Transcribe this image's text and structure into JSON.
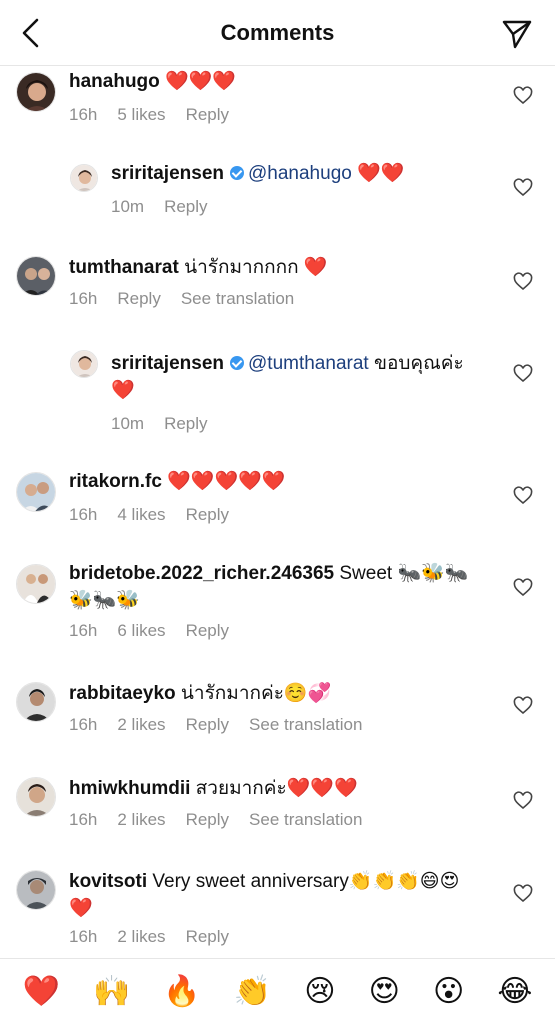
{
  "header": {
    "title": "Comments"
  },
  "comments": [
    {
      "username": "hanahugo",
      "text": " ❤️❤️❤️",
      "time": "16h",
      "likes": "5 likes",
      "reply": "Reply"
    },
    {
      "username": "sriritajensen",
      "mention": "@hanahugo",
      "text": " ❤️❤️",
      "time": "10m",
      "reply": "Reply"
    },
    {
      "username": "tumthanarat",
      "text": " น่ารักมากกกก ❤️",
      "time": "16h",
      "reply": "Reply",
      "translate": "See translation"
    },
    {
      "username": "sriritajensen",
      "mention": "@tumthanarat",
      "text": " ขอบคุณค่ะ❤️",
      "time": "10m",
      "reply": "Reply"
    },
    {
      "username": "ritakorn.fc",
      "text": " ❤️❤️❤️❤️❤️",
      "time": "16h",
      "likes": "4 likes",
      "reply": "Reply"
    },
    {
      "username": "bridetobe.2022_richer.246365",
      "text": " Sweet 🐜🐝🐜🐝🐜🐝",
      "time": "16h",
      "likes": "6 likes",
      "reply": "Reply"
    },
    {
      "username": "rabbitaeyko",
      "text": " น่ารักมากค่ะ☺️💞",
      "time": "16h",
      "likes": "2 likes",
      "reply": "Reply",
      "translate": "See translation"
    },
    {
      "username": "hmiwkhumdii",
      "text": " สวยมากค่ะ❤️❤️❤️",
      "time": "16h",
      "likes": "2 likes",
      "reply": "Reply",
      "translate": "See translation"
    },
    {
      "username": "kovitsoti",
      "text": " Very sweet anniversary👏👏👏😄😍❤️",
      "time": "16h",
      "likes": "2 likes",
      "reply": "Reply"
    }
  ],
  "emoji_bar": [
    "❤️",
    "🙌",
    "🔥",
    "👏",
    "😢",
    "😍",
    "😮",
    "😂"
  ]
}
